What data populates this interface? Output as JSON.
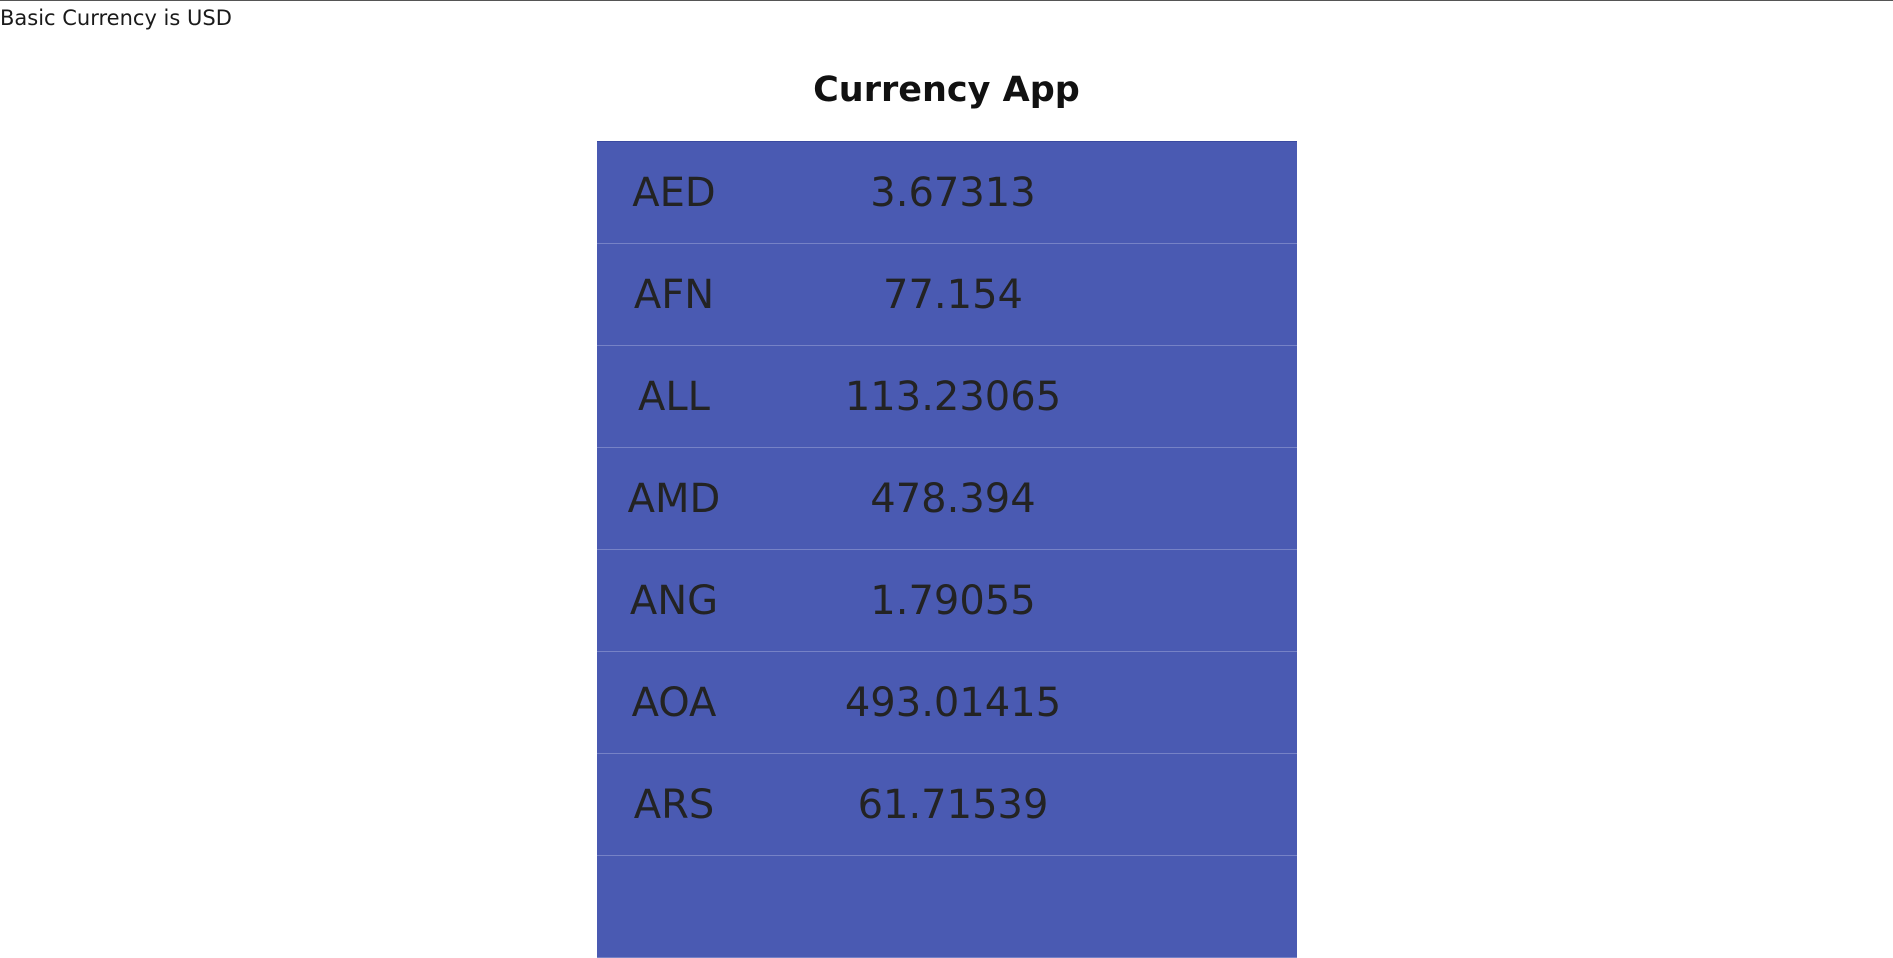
{
  "header": {
    "basic_currency_note": "Basic Currency is USD",
    "title": "Currency App"
  },
  "rates": [
    {
      "code": "AED",
      "value": "3.67313"
    },
    {
      "code": "AFN",
      "value": "77.154"
    },
    {
      "code": "ALL",
      "value": "113.23065"
    },
    {
      "code": "AMD",
      "value": "478.394"
    },
    {
      "code": "ANG",
      "value": "1.79055"
    },
    {
      "code": "AOA",
      "value": "493.01415"
    },
    {
      "code": "ARS",
      "value": "61.71539"
    },
    {
      "code": "",
      "value": ""
    }
  ],
  "colors": {
    "row_background": "#4a5ab2",
    "row_divider": "#7682c6",
    "text": "#232323"
  }
}
